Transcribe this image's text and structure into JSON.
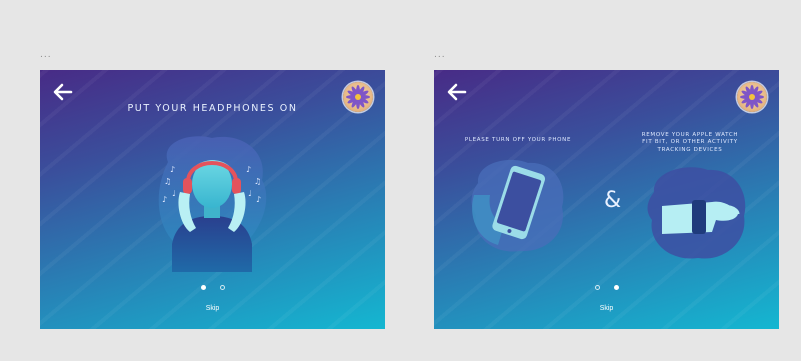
{
  "screens": [
    {
      "ellipsis": "...",
      "title": "PUT YOUR HEADPHONES ON",
      "back_icon": "arrow-left-icon",
      "avatar_icon": "flower-avatar-icon",
      "illustration": "person-with-headphones",
      "pagination": {
        "active": 0,
        "count": 2
      },
      "skip_label": "Skip"
    },
    {
      "ellipsis": "...",
      "left_caption": "PLEASE TURN OFF YOUR PHONE",
      "right_caption_lines": [
        "REMOVE YOUR APPLE WATCH",
        "FIT BIT, OR OTHER ACTIVITY",
        "TRACKING DEVICES"
      ],
      "ampersand": "&",
      "back_icon": "arrow-left-icon",
      "avatar_icon": "flower-avatar-icon",
      "illustration_left": "phone-in-hand",
      "illustration_right": "wrist-with-watch",
      "pagination": {
        "active": 1,
        "count": 2
      },
      "skip_label": "Skip"
    }
  ],
  "colors": {
    "background": "#e6e6e6",
    "gradient_top": "#482b86",
    "gradient_bottom": "#14b7d1",
    "headphones": "#e4535c"
  }
}
